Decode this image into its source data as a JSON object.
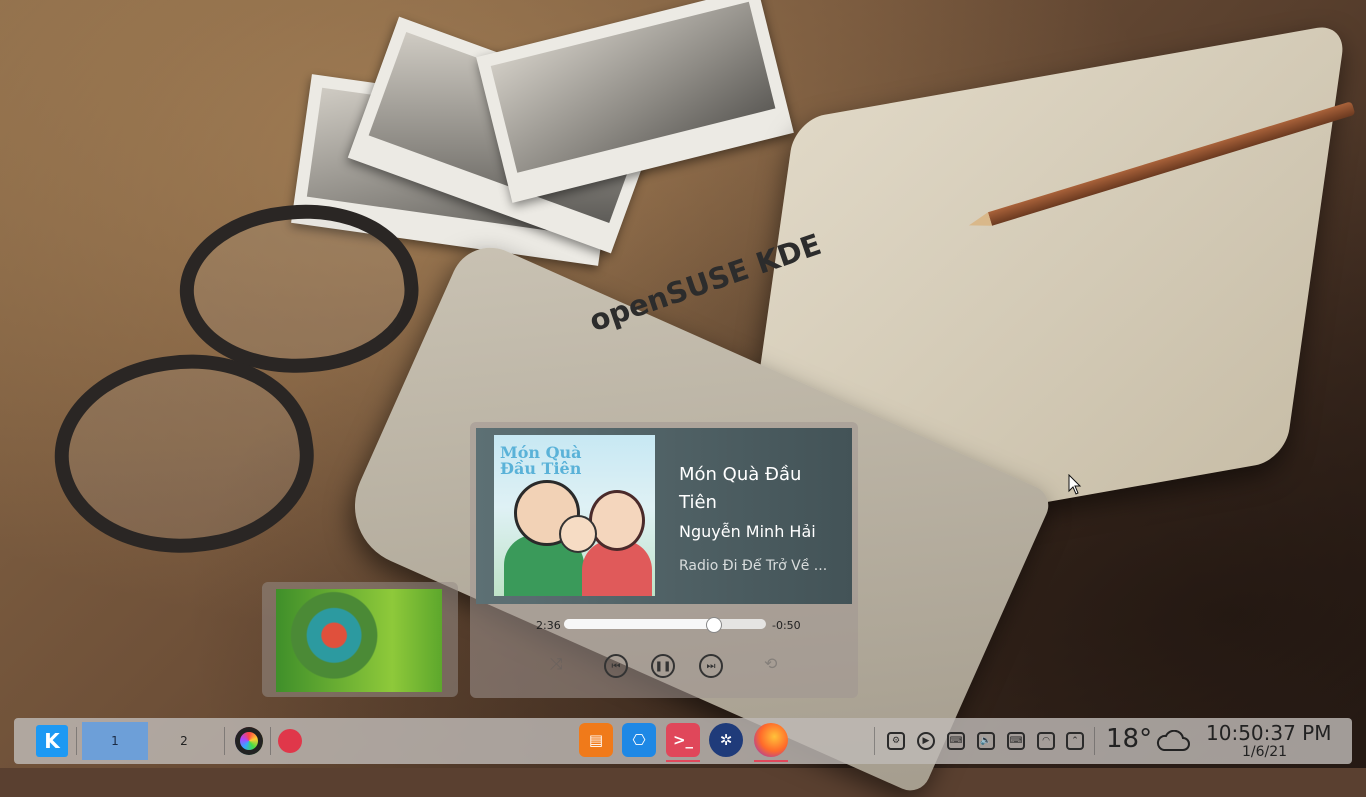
{
  "desktop": {
    "watermark": "openSUSE KDE"
  },
  "media_player": {
    "title": "Món Quà Đầu Tiên",
    "artist": "Nguyễn Minh Hải",
    "album": "Radio Đi Để Trở Về ...",
    "album_art_text": "Món Quà Đầu Tiên",
    "elapsed": "2:36",
    "remaining": "-0:50",
    "progress": 0.74,
    "controls": [
      "shuffle-icon",
      "previous-icon",
      "pause-icon",
      "next-icon",
      "repeat-icon"
    ]
  },
  "taskbar": {
    "pager": [
      {
        "label": "1",
        "active": true
      },
      {
        "label": "2",
        "active": false
      }
    ],
    "launchers": [
      "color-picker-icon",
      "record-icon"
    ],
    "tasks": [
      {
        "name": "store-icon",
        "color": "#f07a1a",
        "active": false
      },
      {
        "name": "vpn-icon",
        "color": "#1e88e5",
        "active": false
      },
      {
        "name": "terminal-icon",
        "color": "#e0475a",
        "active": true
      },
      {
        "name": "settings-wheel-icon",
        "color": "#1f3b7a",
        "active": false
      },
      {
        "name": "firefox-icon",
        "color": "#ff6a2a",
        "active": true
      }
    ],
    "tray": [
      "system-icon",
      "media-icon",
      "keyboard-icon",
      "volume-icon",
      "keyboard-layout-icon",
      "wifi-icon",
      "expand-icon"
    ],
    "weather": {
      "temperature": "18°",
      "icon": "cloud-icon"
    },
    "clock": {
      "time": "10:50:37 PM",
      "date": "1/6/21"
    }
  }
}
